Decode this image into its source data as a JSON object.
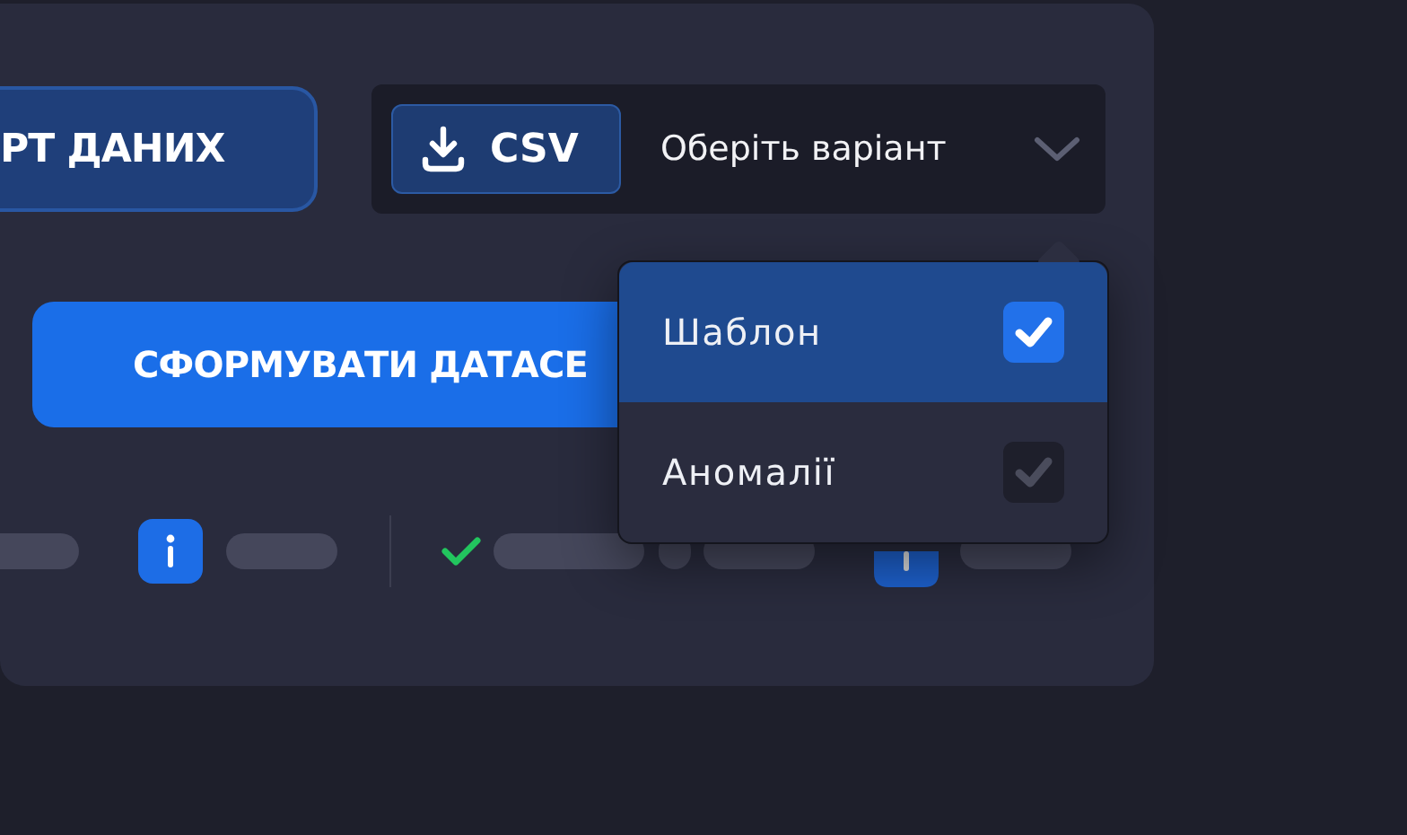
{
  "export_button": {
    "label": "РТ ДАНИХ"
  },
  "format_selector": {
    "format_button": {
      "label": "CSV"
    },
    "label": "Оберіть варіант",
    "expanded": true
  },
  "dropdown_menu": {
    "items": [
      {
        "label": "Шаблон",
        "selected": true,
        "checked": true
      },
      {
        "label": "Аномалії",
        "selected": false,
        "checked": false
      }
    ]
  },
  "generate_button": {
    "label": "СФОРМУВАТИ ДАТАСЕ"
  }
}
